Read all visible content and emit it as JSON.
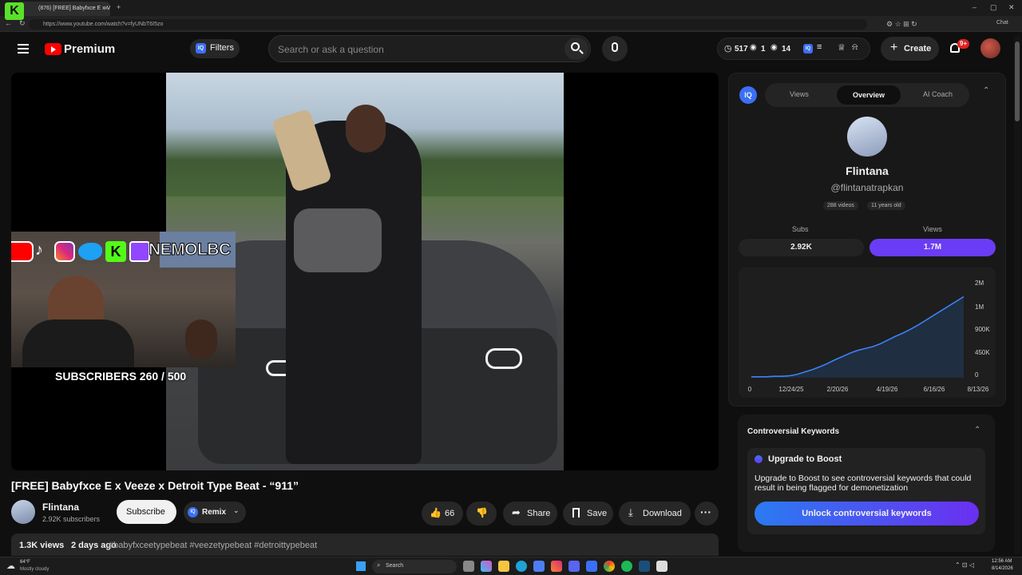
{
  "browser": {
    "tab_title": "(876) [FREE] Babyfxce E x Veez",
    "url": "https://www.youtube.com/watch?v=fyUNbT6I5zo",
    "chat_label": "Chat"
  },
  "header": {
    "brand": "Premium",
    "filters_label": "Filters",
    "search_placeholder": "Search or ask a question",
    "stat_watch": "517",
    "stat_eye1": "1",
    "stat_eye2": "14",
    "create_label": "Create",
    "notif_badge": "9+"
  },
  "overlay": {
    "handle": "NEMOLBC",
    "subs_text": "SUBSCRIBERS 260 / 500"
  },
  "video": {
    "title": "[FREE] Babyfxce E x Veeze x Detroit Type Beat - “911”",
    "channel": "Flintana",
    "subscribers": "2.92K subscribers",
    "subscribe_label": "Subscribe",
    "remix_label": "Remix",
    "likes": "66",
    "share_label": "Share",
    "save_label": "Save",
    "download_label": "Download",
    "views": "1.3K views",
    "age": "2 days ago",
    "tags": "#babyfxceetypebeat #veezetypebeat #detroittypebeat"
  },
  "panel": {
    "tabs": [
      "Views",
      "Overview",
      "AI Coach"
    ],
    "channel_name": "Flintana",
    "handle": "@flintanatrapkan",
    "videos_badge": "288 videos",
    "age_badge": "11 years old",
    "subs_label": "Subs",
    "views_label": "Views",
    "subs_value": "2.92K",
    "views_value": "1.7M",
    "accent": "#6b3cf5"
  },
  "chart_data": {
    "type": "area",
    "x_ticks": [
      "0",
      "12/24/25",
      "2/20/26",
      "4/19/26",
      "6/16/26",
      "8/13/26"
    ],
    "y_ticks": [
      "2M",
      "1M",
      "900K",
      "450K",
      "0"
    ],
    "values": [
      0.02,
      0.02,
      0.02,
      0.03,
      0.03,
      0.04,
      0.07,
      0.12,
      0.17,
      0.23,
      0.3,
      0.38,
      0.45,
      0.52,
      0.58,
      0.62,
      0.66,
      0.72,
      0.8,
      0.88,
      0.95,
      1.03,
      1.12,
      1.22,
      1.32,
      1.42,
      1.52,
      1.62,
      1.72
    ],
    "series_color": "#3b82f6"
  },
  "keywords": {
    "title": "Controversial Keywords",
    "boost_title": "Upgrade to Boost",
    "boost_text": "Upgrade to Boost to see controversial keywords that could result in being flagged for demonetization",
    "unlock_label": "Unlock controversial keywords"
  },
  "taskbar": {
    "weather_temp": "64°F",
    "weather_desc": "Mostly cloudy",
    "search_label": "Search",
    "time": "12:56 AM",
    "date": "8/14/2026"
  }
}
